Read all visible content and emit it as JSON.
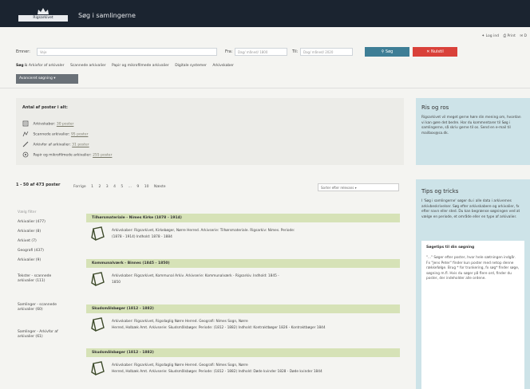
{
  "header": {
    "logo_text": "Rigsarkivet",
    "app_title": "Søg i samlingerne"
  },
  "top_links": [
    "✦ Log ind",
    "⎙ Print",
    "✉ D"
  ],
  "search": {
    "label": "Emner:",
    "query": "Veje",
    "from_label": "Fra:",
    "from_value": "Dag/ måned/ 1800",
    "to_label": "Til:",
    "to_value": "Dag/ måned/ 2020",
    "search_button": "⚲ Søg",
    "reset_button": "✕ Nulstil"
  },
  "scope": {
    "label": "Søg i:",
    "options": [
      "Arkivfor af arkivaler",
      "Scannede arkivalier",
      "Papir og mikrofilmede arkivalier",
      "Digitale systemer",
      "Arkivskaber"
    ]
  },
  "advanced_button": "Avanceret søgning ▾",
  "stats": {
    "title": "Antal af poster i alt:",
    "items": [
      {
        "icon": "archive-creator-icon",
        "label": "Arkivskaber:",
        "count": "30 poster"
      },
      {
        "icon": "scanned-icon",
        "label": "Scannede arkivalier:",
        "count": "95 poster"
      },
      {
        "icon": "pencil-icon",
        "label": "Arkivfor af arkivalier:",
        "count": "31 poster"
      },
      {
        "icon": "film-icon",
        "label": "Papir og mikrofilmede arkivalier:",
        "count": "255 poster"
      }
    ]
  },
  "sidebar": {
    "box1_title": "Ris og ros",
    "box1_text": "Rigsarkivet vil meget gerne høre din mening om, hvordan vi kan gøre det bedre. Har du kommentarer til Søg i samlingerne, så skriv gerne til os. Send en e-mail til mailbox@sa.dk.",
    "box2_title": "Tips og tricks",
    "box2_text": "I 'Søg i samlingerne' søger du i alle data i arkivernes arkivbeskrivelser. Søg efter arkivskabere og arkivalier, fx efter navn eller sted. Du kan begrænse søgningen ved at vælge en periode, et område eller en type af arkivalier.",
    "box3_title": "Søgetips til din søgning",
    "box3_text": "\"...\" Søger efter poster, hvor hele sætningen indgår. Fx \"Jens Peter\" finder kun poster med netop denne rækkefølge. Brug * for trunkering, fx søg* finder søge, søgning m.fl. Hvis du søger på flere ord, finder du poster, der indeholder alle ordene."
  },
  "results": {
    "count_text": "1 - 50 af 473 poster",
    "pager": [
      "Forrige",
      "1",
      "2",
      "3",
      "4",
      "5",
      "...",
      "9",
      "10",
      "Næste"
    ],
    "sort": "Sorter efter relevans ▾",
    "facets": [
      "Vælg filter",
      "Arkivalier (477)",
      "Arkivalier (8)",
      "Arkivet (7)",
      "Geografi (437)",
      "Arkivalier (9)",
      "Tekster - scannede arkivalier (111)",
      "Samlinger - scannede arkivalier (60)",
      "Samlinger - Arkivfor af arkivalier (61)"
    ],
    "items": [
      {
        "title": "Tilhørsmateriale - Nimes Kirke (1878 - 1914)",
        "line1": "Arkivskaber: Rigsarkivet, Kirkebøger, Nørre Herred. Arkivserie: Tilhørsmateriale. Rigsarkiv: Nimes. Periode:",
        "line2": "(1878 - 1914) Indhold: 1878 - 1884"
      },
      {
        "title": "Kommunalværk - Binnes (1845 - 1850)",
        "line1": "Arkivskaber: Rigsarkivet, Kommunal Arkiv. Arkivserie: Kommunalværk - Rigsarkiv. Indhold: 1845 -",
        "line2": "1850"
      },
      {
        "title": "Skudsmålsbøger (1812 - 1882)",
        "line1": "Arkivskaber: Rigsarkivet, Rigsdaglig Nørre Herred. Geografi: Nimes Sogn, Nørre",
        "line2": "Herred, Holbæk Amt. Arkivserie: Skudsmålsbøger. Periode: (1812 - 1882) Indhold: Kontraktbøger 1826 - Kontraktbøger 1844"
      },
      {
        "title": "Skudsmålsbøger (1812 - 1882)",
        "line1": "Arkivskaber: Rigsarkivet, Rigsdaglig Nørre Herred. Geografi: Nimes Sogn, Nørre",
        "line2": "Herred, Holbæk Amt. Arkivserie: Skudsmålsbøger. Periode: (1812 - 1882) Indhold: Døde kvinder 1828 - Døde kvinder 1844"
      }
    ]
  },
  "colors": {
    "topbar": "#1b2430",
    "search_button": "#3e7e96",
    "reset_button": "#d9413a",
    "result_header": "#d6e2b7",
    "sidebar": "#cde3e8"
  }
}
